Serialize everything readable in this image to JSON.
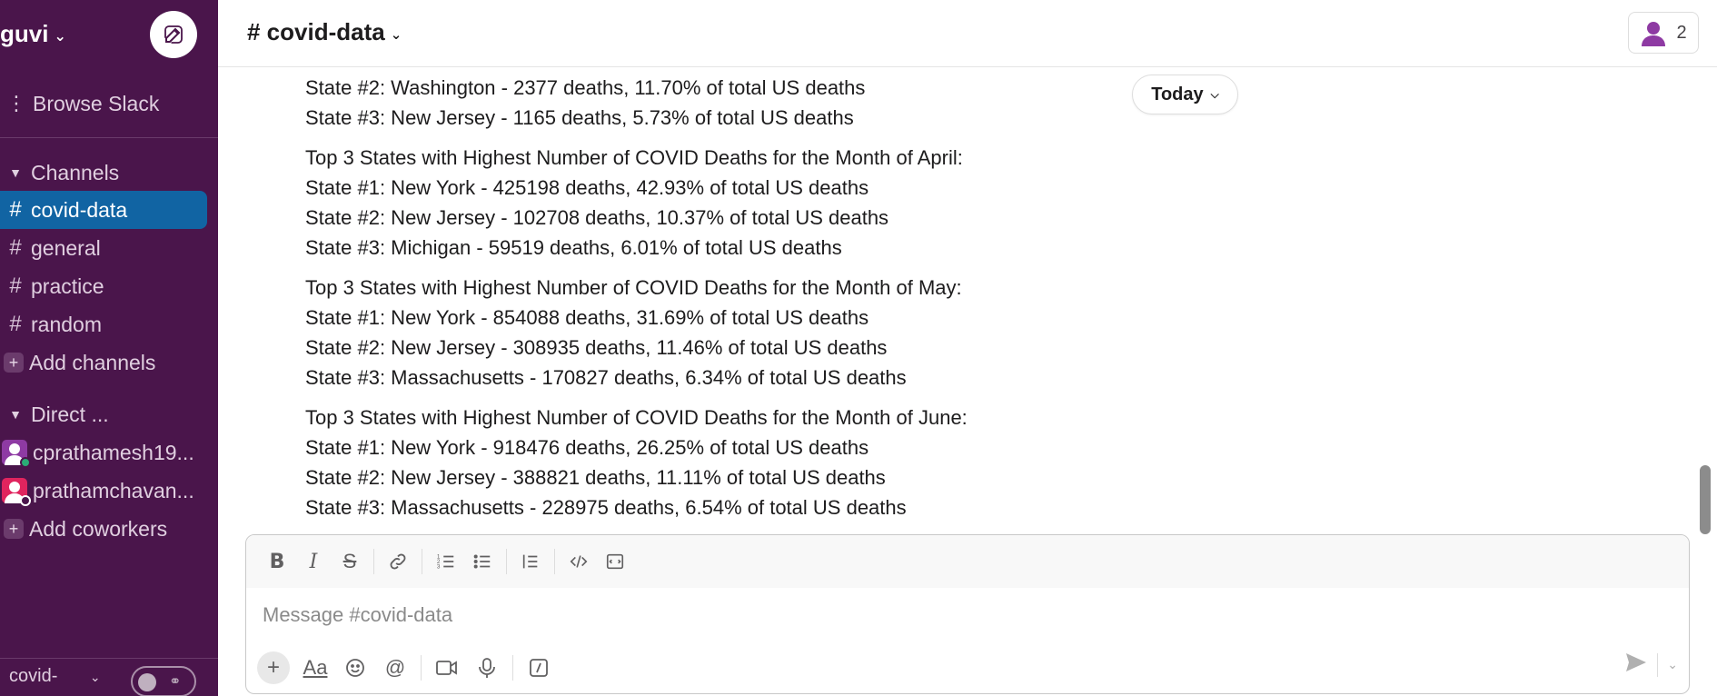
{
  "workspace": {
    "name": "guvi"
  },
  "sidebar": {
    "browse_label": "Browse Slack",
    "channels_header": "Channels",
    "channels": [
      {
        "label": "covid-data",
        "active": true
      },
      {
        "label": "general",
        "active": false
      },
      {
        "label": "practice",
        "active": false
      },
      {
        "label": "random",
        "active": false
      }
    ],
    "add_channels": "Add channels",
    "dm_header": "Direct ...",
    "dms": [
      {
        "label": "cprathamesh19...",
        "avatar_color": "#8e3aa3",
        "status_color": "#2bac76"
      },
      {
        "label": "prathamchavan...",
        "avatar_color": "#e0245e",
        "status_color": "#ffffff"
      }
    ],
    "add_coworkers": "Add coworkers",
    "footer_text": "covid-"
  },
  "header": {
    "channel_title": "# covid-data",
    "member_count": "2"
  },
  "today_label": "Today",
  "messages": [
    {
      "lines": [
        "State #2: Washington - 2377 deaths, 11.70% of total US deaths",
        "State #3: New Jersey - 1165 deaths, 5.73% of total US deaths"
      ]
    },
    {
      "lines": [
        "Top 3 States with Highest Number of COVID Deaths for the Month of April:",
        "State #1: New York - 425198 deaths, 42.93% of total US deaths",
        "State #2: New Jersey - 102708 deaths, 10.37% of total US deaths",
        "State #3: Michigan - 59519 deaths, 6.01% of total US deaths"
      ]
    },
    {
      "lines": [
        "Top 3 States with Highest Number of COVID Deaths for the Month of May:",
        "State #1: New York - 854088 deaths, 31.69% of total US deaths",
        "State #2: New Jersey - 308935 deaths, 11.46% of total US deaths",
        "State #3: Massachusetts - 170827 deaths, 6.34% of total US deaths"
      ]
    },
    {
      "lines": [
        "Top 3 States with Highest Number of COVID Deaths for the Month of June:",
        "State #1: New York - 918476 deaths, 26.25% of total US deaths",
        "State #2: New Jersey - 388821 deaths, 11.11% of total US deaths",
        "State #3: Massachusetts - 228975 deaths, 6.54% of total US deaths"
      ]
    }
  ],
  "composer": {
    "placeholder": "Message #covid-data",
    "format_icons": [
      "bold-icon",
      "italic-icon",
      "strikethrough-icon",
      "link-icon",
      "ordered-list-icon",
      "bulleted-list-icon",
      "blockquote-icon",
      "code-icon",
      "code-block-icon"
    ],
    "action_icons": [
      "plus-icon",
      "text-format-icon",
      "emoji-icon",
      "mention-icon",
      "video-icon",
      "microphone-icon",
      "slash-command-icon",
      "send-icon"
    ]
  },
  "colors": {
    "sidebar_bg": "#4a154b",
    "active_channel_bg": "#1164a3",
    "text": "#1d1c1d"
  }
}
